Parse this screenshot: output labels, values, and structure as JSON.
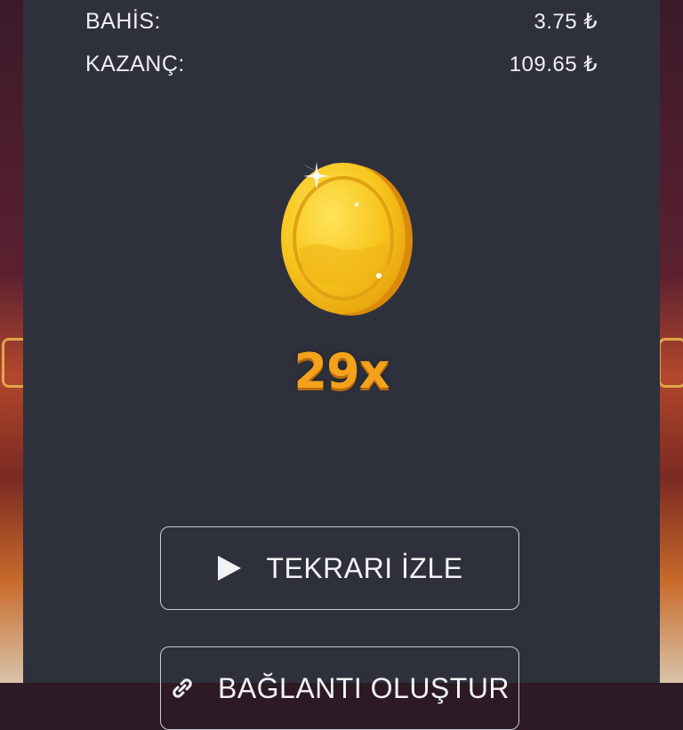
{
  "result": {
    "bet_label": "BAHİS:",
    "bet_value": "3.75 ₺",
    "win_label": "KAZANÇ:",
    "win_value": "109.65 ₺",
    "multiplier": "29x"
  },
  "actions": {
    "replay_label": "TEKRARI İZLE",
    "replay_icon": "play-icon",
    "link_label": "BAĞLANTI OLUŞTUR",
    "link_icon": "link-icon"
  },
  "colors": {
    "panel": "#2e313c",
    "text": "#eef0f4",
    "multiplier": "#f4a21c",
    "coin": "#f7c51e"
  }
}
